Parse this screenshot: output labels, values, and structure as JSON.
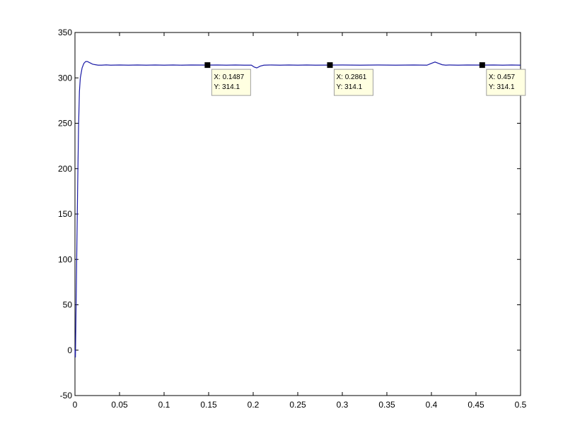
{
  "chart_data": {
    "type": "line",
    "title": "",
    "xlabel": "",
    "ylabel": "",
    "xlim": [
      0,
      0.5
    ],
    "ylim": [
      -50,
      350
    ],
    "xticks": [
      "0",
      "0.05",
      "0.1",
      "0.15",
      "0.2",
      "0.25",
      "0.3",
      "0.35",
      "0.4",
      "0.45",
      "0.5"
    ],
    "xtick_values": [
      0,
      0.05,
      0.1,
      0.15,
      0.2,
      0.25,
      0.3,
      0.35,
      0.4,
      0.45,
      0.5
    ],
    "yticks": [
      "-50",
      "0",
      "50",
      "100",
      "150",
      "200",
      "250",
      "300",
      "350"
    ],
    "ytick_values": [
      -50,
      0,
      50,
      100,
      150,
      200,
      250,
      300,
      350
    ],
    "grid": false,
    "legend": "none",
    "colors": {
      "line": "#1a1aa6",
      "marker": "#000000",
      "tip_bg": "#ffffe1",
      "tip_border": "#a0a0a0",
      "axes": "#000000"
    },
    "series": [
      {
        "x": [
          0,
          0.0005,
          0.001,
          0.002,
          0.003,
          0.004,
          0.005,
          0.006,
          0.008,
          0.01,
          0.012,
          0.014,
          0.016,
          0.018,
          0.02,
          0.023,
          0.026,
          0.03,
          0.035,
          0.04,
          0.05,
          0.06,
          0.07,
          0.08,
          0.09,
          0.1,
          0.11,
          0.12,
          0.13,
          0.1487,
          0.16,
          0.17,
          0.18,
          0.19,
          0.198,
          0.201,
          0.204,
          0.208,
          0.212,
          0.22,
          0.23,
          0.24,
          0.25,
          0.26,
          0.27,
          0.2861,
          0.3,
          0.32,
          0.34,
          0.36,
          0.38,
          0.395,
          0.4,
          0.404,
          0.408,
          0.412,
          0.416,
          0.42,
          0.43,
          0.44,
          0.457,
          0.47,
          0.48,
          0.49,
          0.5
        ],
        "y": [
          0,
          -8,
          30,
          105,
          180,
          245,
          285,
          300,
          311,
          316,
          318,
          318,
          317,
          316,
          315,
          314.5,
          314,
          314,
          314.3,
          314,
          314.2,
          314,
          314.2,
          314,
          314.2,
          314,
          314.2,
          314,
          314.2,
          314.1,
          314.2,
          314,
          314.2,
          314,
          314,
          312,
          311,
          313,
          314,
          314.2,
          314,
          314.2,
          314,
          314.2,
          314,
          314.1,
          314.2,
          314,
          314.2,
          314,
          314.2,
          314,
          316,
          317.5,
          316,
          314.5,
          314,
          314.2,
          314,
          314.2,
          314.1,
          314.2,
          314,
          314.2,
          314
        ]
      }
    ],
    "datatips": [
      {
        "x": 0.1487,
        "y": 314.1,
        "line1": "X: 0.1487",
        "line2": "Y: 314.1"
      },
      {
        "x": 0.2861,
        "y": 314.1,
        "line1": "X: 0.2861",
        "line2": "Y: 314.1"
      },
      {
        "x": 0.457,
        "y": 314.1,
        "line1": "X: 0.457",
        "line2": "Y: 314.1"
      }
    ]
  }
}
